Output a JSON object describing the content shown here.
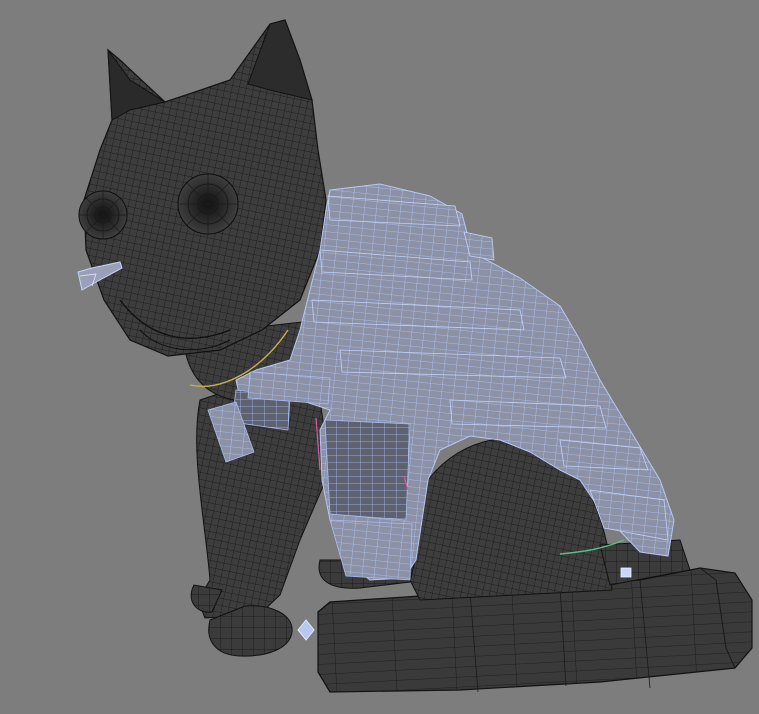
{
  "viewport": {
    "background_color": "#7d7d7d"
  },
  "model": {
    "body_color": "#3a3a3a",
    "body_wire_color": "#151515",
    "selected_wire_color": "#a9bdf0",
    "selected_fill_color": "#8e93a8",
    "edge_highlight_colors": [
      "#c8b046",
      "#5dbb8a",
      "#d060a0"
    ]
  }
}
